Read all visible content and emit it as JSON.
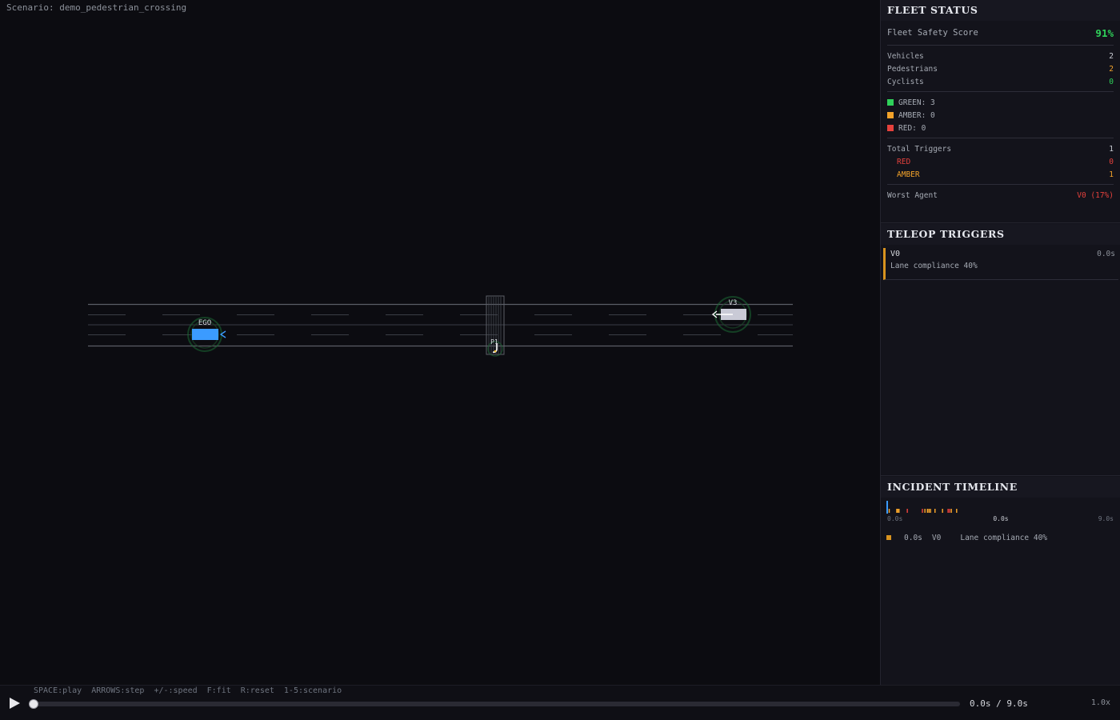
{
  "scenario_label": "Scenario: demo_pedestrian_crossing",
  "agents": {
    "ego_label": "EGO",
    "v3_label": "V3",
    "pedestrian_label": "P1"
  },
  "fleet_status": {
    "title": "FLEET STATUS",
    "score_label": "Fleet Safety Score",
    "score_value": "91%",
    "vehicles_label": "Vehicles",
    "vehicles_value": "2",
    "pedestrians_label": "Pedestrians",
    "pedestrians_value": "2",
    "cyclists_label": "Cyclists",
    "cyclists_value": "0",
    "green_label": "GREEN: 3",
    "amber_label": "AMBER: 0",
    "red_label": "RED: 0",
    "total_triggers_label": "Total Triggers",
    "total_triggers_value": "1",
    "red_triggers_label": "RED",
    "red_triggers_value": "0",
    "amber_triggers_label": "AMBER",
    "amber_triggers_value": "1",
    "worst_agent_label": "Worst Agent",
    "worst_agent_value": "V0 (17%)"
  },
  "teleop": {
    "title": "TELEOP TRIGGERS",
    "triggers": [
      {
        "agent": "V0",
        "time": "0.0s",
        "message": "Lane compliance 40%"
      }
    ]
  },
  "timeline": {
    "title": "INCIDENT TIMELINE",
    "start_label": "0.0s",
    "current_label": "0.0s",
    "end_label": "9.0s",
    "duration": 9.0,
    "current": 0.0,
    "marks": [
      {
        "t": 0.08,
        "level": "amber"
      },
      {
        "t": 0.38,
        "level": "amber"
      },
      {
        "t": 0.42,
        "level": "amber"
      },
      {
        "t": 0.47,
        "level": "amber"
      },
      {
        "t": 0.8,
        "level": "red"
      },
      {
        "t": 1.4,
        "level": "red"
      },
      {
        "t": 1.5,
        "level": "amber"
      },
      {
        "t": 1.6,
        "level": "amber"
      },
      {
        "t": 1.66,
        "level": "amber"
      },
      {
        "t": 1.72,
        "level": "amber"
      },
      {
        "t": 1.9,
        "level": "amber"
      },
      {
        "t": 2.2,
        "level": "amber"
      },
      {
        "t": 2.42,
        "level": "red"
      },
      {
        "t": 2.48,
        "level": "red"
      },
      {
        "t": 2.55,
        "level": "amber"
      },
      {
        "t": 2.76,
        "level": "amber"
      }
    ],
    "entries": [
      {
        "time": "0.0s",
        "agent": "V0",
        "message": "Lane compliance 40%"
      }
    ]
  },
  "controls": {
    "hotkeys": [
      "SPACE:play",
      "ARROWS:step",
      "+/-:speed",
      "F:fit",
      "R:reset",
      "1-5:scenario"
    ],
    "time_readout": "0.0s / 9.0s",
    "speed_readout": "1.0x",
    "progress": 0.0
  },
  "colors": {
    "green": "#2fd15a",
    "amber": "#f2a22a",
    "red": "#e5413c",
    "ego": "#3b9bff"
  },
  "icons": {
    "play": "play-icon"
  }
}
